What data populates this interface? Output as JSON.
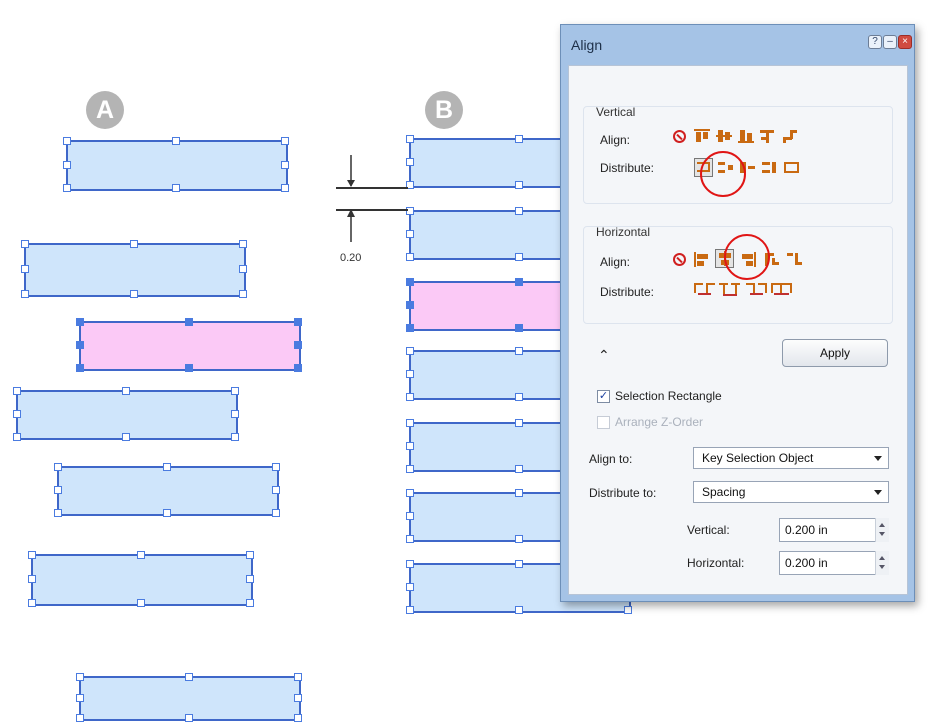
{
  "badges": {
    "a": "A",
    "b": "B"
  },
  "dimension": {
    "value": "0.20"
  },
  "panel": {
    "title": "Align",
    "window_buttons": {
      "help": "?",
      "minimize": "–",
      "close": "×"
    },
    "vertical": {
      "group_label": "Vertical",
      "align_label": "Align:",
      "distribute_label": "Distribute:"
    },
    "horizontal": {
      "group_label": "Horizontal",
      "align_label": "Align:",
      "distribute_label": "Distribute:"
    },
    "collapse_icon": "⌃",
    "apply_label": "Apply",
    "selection_rectangle": {
      "label": "Selection Rectangle",
      "checked": true
    },
    "arrange_z_order": {
      "label": "Arrange Z-Order",
      "checked": false,
      "disabled": true
    },
    "align_to": {
      "label": "Align to:",
      "value": "Key Selection Object"
    },
    "distribute_to": {
      "label": "Distribute to:",
      "value": "Spacing"
    },
    "vertical_spacing": {
      "label": "Vertical:",
      "value": "0.200 in"
    },
    "horizontal_spacing": {
      "label": "Horizontal:",
      "value": "0.200 in"
    }
  },
  "colors": {
    "shape_fill": "#cfe5fb",
    "key_shape_fill": "#fbc9f6",
    "shape_border": "#3f67c9",
    "highlight_circle": "#e01515",
    "icon_orange": "#c96a12"
  }
}
